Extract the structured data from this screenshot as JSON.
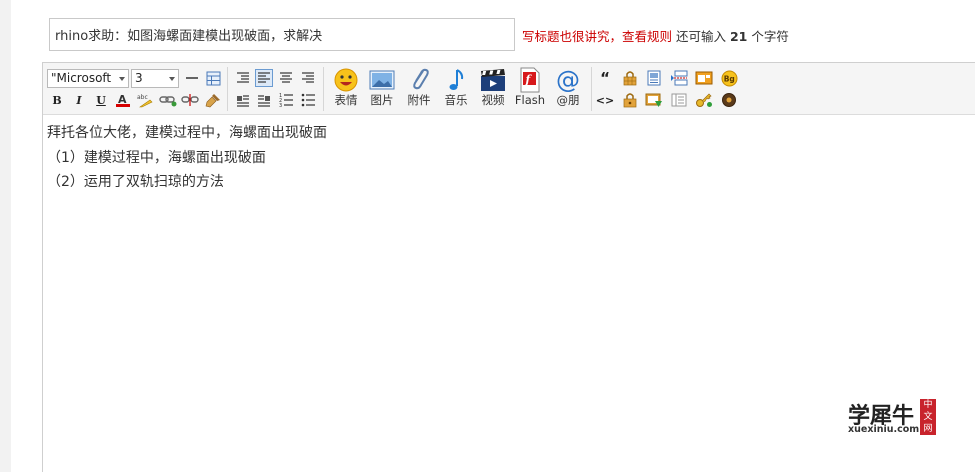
{
  "title": {
    "value": "rhino求助：如图海螺面建模出现破面，求解决",
    "hint_red": "写标题也很讲究，查看规则",
    "hint_prefix": " 还可输入 ",
    "remaining": "21",
    "hint_suffix": " 个字符"
  },
  "toolbar": {
    "font_family": "\"Microsoft",
    "font_size": "3",
    "insert_buttons": [
      {
        "label": "表情",
        "icon": "emoji-icon"
      },
      {
        "label": "图片",
        "icon": "image-icon"
      },
      {
        "label": "附件",
        "icon": "paperclip-icon"
      },
      {
        "label": "音乐",
        "icon": "music-icon"
      },
      {
        "label": "视频",
        "icon": "video-icon"
      },
      {
        "label": "Flash",
        "icon": "flash-icon"
      },
      {
        "label": "@朋",
        "icon": "at-icon"
      }
    ],
    "bold": "B",
    "italic": "I",
    "underline": "U",
    "quote": "“",
    "code": "<>",
    "bg_badge": "Bg"
  },
  "content": {
    "lines": [
      "拜托各位大佬，建模过程中，海螺面出现破面",
      "（1）建模过程中，海螺面出现破面",
      "（2）运用了双轨扫琼的方法"
    ]
  },
  "watermark": {
    "main": "学犀牛",
    "domain": "xuexiniu.com",
    "badge": "中文网"
  },
  "colors": {
    "hint_red": "#cc0000",
    "watermark_badge": "#c8232c",
    "active_button_bg": "#dde9f7"
  }
}
